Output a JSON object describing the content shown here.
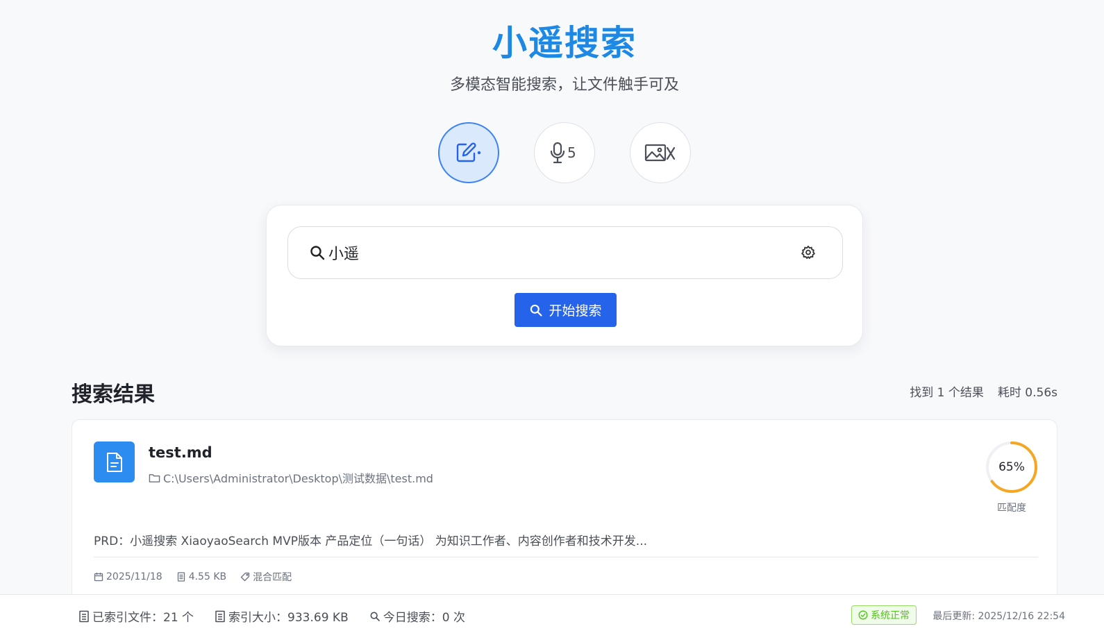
{
  "header": {
    "title": "小遥搜索",
    "subtitle": "多模态智能搜索，让文件触手可及"
  },
  "modes": [
    {
      "name": "text-mode",
      "icon": "edit-icon",
      "active": true
    },
    {
      "name": "voice-mode",
      "icon": "microphone-icon",
      "suffix": "5",
      "active": false
    },
    {
      "name": "image-mode",
      "icon": "image-icon",
      "suffix": "X",
      "active": false
    }
  ],
  "search": {
    "value": "小遥",
    "button_label": "开始搜索"
  },
  "results": {
    "heading": "搜索结果",
    "found_text": "找到 1 个结果",
    "time_text": "耗时 0.56s",
    "items": [
      {
        "file_name": "test.md",
        "path": "C:\\Users\\Administrator\\Desktop\\测试数据\\test.md",
        "score_text": "65%",
        "score_value": 0.65,
        "score_label": "匹配度",
        "snippet": "PRD：小遥搜索 XiaoyaoSearch MVP版本 产品定位（一句话） 为知识工作者、内容创作者和技术开发...",
        "date": "2025/11/18",
        "size": "4.55 KB",
        "match_type": "混合匹配"
      }
    ]
  },
  "footer": {
    "indexed_files": "已索引文件：21 个",
    "index_size": "索引大小：933.69 KB",
    "today_searches": "今日搜索：0 次",
    "status": "系统正常",
    "last_update": "最后更新: 2025/12/16 22:54"
  },
  "colors": {
    "brand": "#1e88e5",
    "primary": "#2563eb",
    "score_ring": "#f5a623",
    "status_ok": "#52c41a"
  }
}
